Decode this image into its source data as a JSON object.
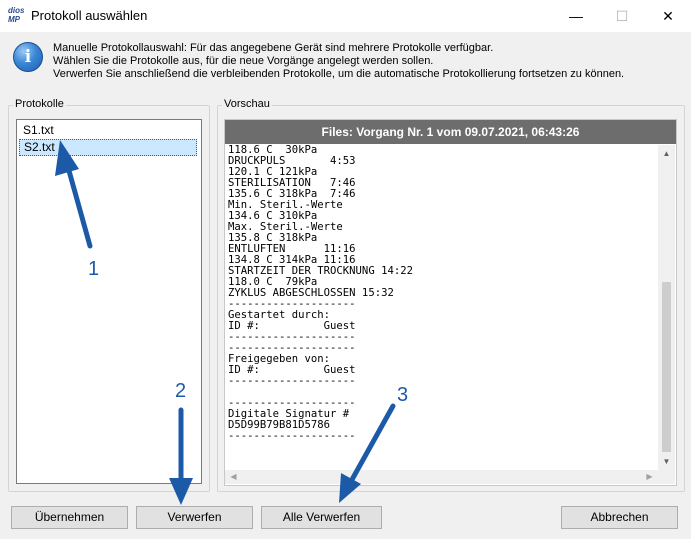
{
  "window": {
    "logo_line1": "dios",
    "logo_line2": "MP",
    "title": "Protokoll auswählen",
    "min_glyph": "—",
    "max_glyph": "☐",
    "close_glyph": "✕"
  },
  "info": {
    "icon": "info-icon",
    "icon_glyph": "i",
    "lines": [
      "Manuelle Protokollauswahl: Für das angegebene Gerät sind mehrere Protokolle verfügbar.",
      "Wählen Sie die Protokolle aus, für die neue Vorgänge angelegt werden sollen.",
      "Verwerfen Sie anschließend die verbleibenden Protokolle, um die automatische Protokollierung fortsetzen zu können."
    ]
  },
  "protokolle": {
    "label": "Protokolle",
    "items": [
      "S1.txt",
      "S2.txt"
    ],
    "selected_index": 1
  },
  "vorschau": {
    "label": "Vorschau",
    "header": "Files: Vorgang Nr. 1 vom 09.07.2021, 06:43:26",
    "content": "118.6 C  30kPa\nDRUCKPULS       4:53\n120.1 C 121kPa\nSTERILISATION   7:46\n135.6 C 318kPa  7:46\nMin. Steril.-Werte\n134.6 C 310kPa\nMax. Steril.-Werte\n135.8 C 318kPa\nENTLUFTEN      11:16\n134.8 C 314kPa 11:16\nSTARTZEIT DER TROCKNUNG 14:22\n118.0 C  79kPa\nZYKLUS ABGESCHLOSSEN 15:32\n--------------------\nGestartet durch:\nID #:          Guest\n--------------------\n--------------------\nFreigegeben von:\nID #:          Guest\n--------------------\n\n--------------------\nDigitale Signatur #\nD5D99B79B81D5786\n--------------------"
  },
  "buttons": {
    "uebernehmen": "Übernehmen",
    "verwerfen": "Verwerfen",
    "alle_verwerfen": "Alle Verwerfen",
    "abbrechen": "Abbrechen"
  },
  "annotations": {
    "one": "1",
    "two": "2",
    "three": "3",
    "color": "#1c5aa8"
  }
}
